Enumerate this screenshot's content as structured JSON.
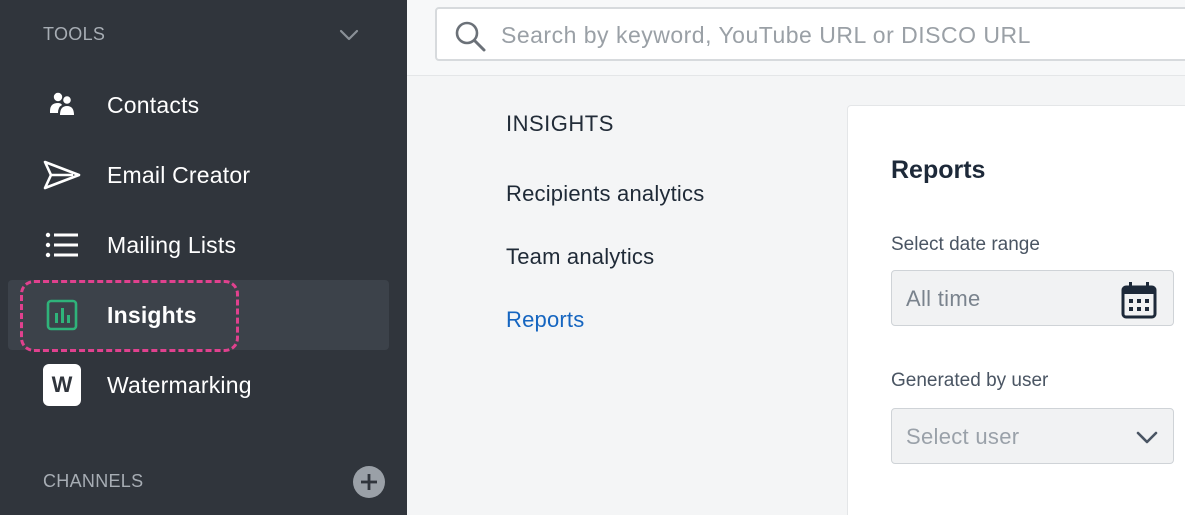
{
  "sidebar": {
    "tools_label": "TOOLS",
    "channels_label": "CHANNELS",
    "items": [
      {
        "label": "Contacts",
        "icon": "contacts-icon"
      },
      {
        "label": "Email Creator",
        "icon": "send-icon"
      },
      {
        "label": "Mailing Lists",
        "icon": "list-icon"
      },
      {
        "label": "Insights",
        "icon": "bar-chart-icon",
        "active": true
      },
      {
        "label": "Watermarking",
        "icon": "watermark-icon",
        "badge": "W"
      }
    ]
  },
  "search": {
    "placeholder": "Search by keyword, YouTube URL or DISCO URL"
  },
  "insights_nav": {
    "title": "INSIGHTS",
    "items": [
      {
        "label": "Recipients analytics"
      },
      {
        "label": "Team analytics"
      },
      {
        "label": "Reports",
        "current": true
      }
    ]
  },
  "reports": {
    "title": "Reports",
    "date_range_label": "Select date range",
    "date_range_value": "All time",
    "user_label": "Generated by user",
    "user_placeholder": "Select user"
  },
  "colors": {
    "sidebar_bg": "#30353c",
    "accent_link": "#1565c0",
    "insights_icon": "#2fb37a",
    "highlight": "#e0418e"
  }
}
